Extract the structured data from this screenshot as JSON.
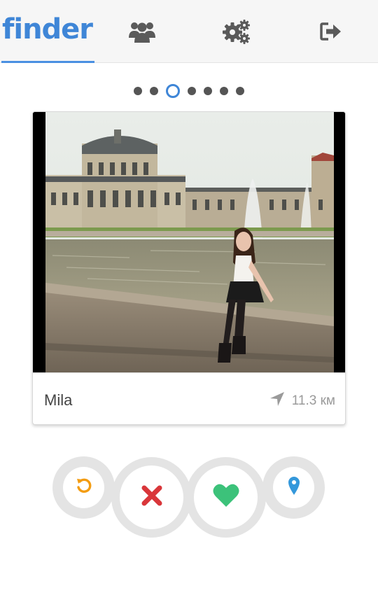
{
  "header": {
    "logo_text": "finder",
    "tabs": [
      {
        "icon": "finder-logo",
        "active": true
      },
      {
        "icon": "users-icon",
        "active": false
      },
      {
        "icon": "settings-gears-icon",
        "active": false
      },
      {
        "icon": "logout-icon",
        "active": false
      }
    ],
    "accent_color": "#3f86d7"
  },
  "pagination": {
    "count": 7,
    "active_index": 2
  },
  "profile_card": {
    "name": "Mila",
    "distance": "11.3 км",
    "location_icon": "navigation-arrow-icon"
  },
  "actions": [
    {
      "name": "undo-button",
      "icon": "undo-icon",
      "color": "#f39c12"
    },
    {
      "name": "dislike-button",
      "icon": "close-x-icon",
      "color": "#d9363a"
    },
    {
      "name": "like-button",
      "icon": "heart-icon",
      "color": "#3cc27a"
    },
    {
      "name": "location-button",
      "icon": "map-pin-icon",
      "color": "#3498db"
    }
  ]
}
